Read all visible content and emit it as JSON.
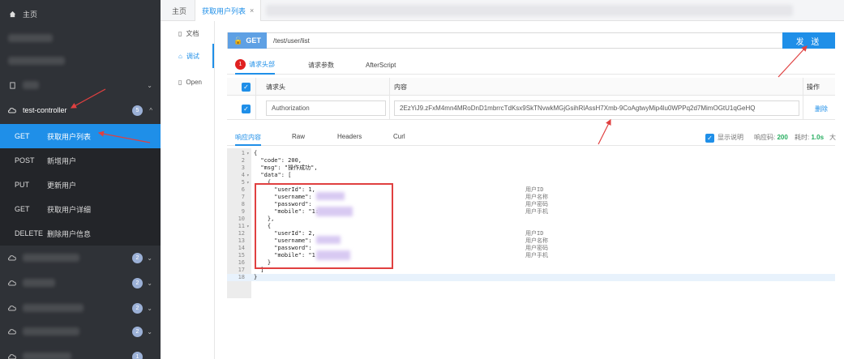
{
  "sidebar": {
    "home_label": "主页",
    "group_label": "test-controller",
    "group_badge": "5",
    "other_badges": [
      "2",
      "2",
      "2",
      "2",
      "1"
    ],
    "endpoints": [
      {
        "method": "GET",
        "name": "获取用户列表"
      },
      {
        "method": "POST",
        "name": "新增用户"
      },
      {
        "method": "PUT",
        "name": "更新用户"
      },
      {
        "method": "GET",
        "name": "获取用户详细"
      },
      {
        "method": "DELETE",
        "name": "删除用户信息"
      }
    ]
  },
  "tabs": {
    "home": "主页",
    "current": "获取用户列表",
    "close_icon": "×"
  },
  "subnav": {
    "doc": "文档",
    "debug": "调试",
    "open": "Open"
  },
  "request": {
    "method": "GET",
    "url": "/test/user/list",
    "send_label": "发 送",
    "tabs": {
      "step": "1",
      "headers": "请求头部",
      "params": "请求参数",
      "after_script": "AfterScript"
    }
  },
  "header_table": {
    "col_name": "请求头",
    "col_value": "内容",
    "col_action": "操作",
    "row": {
      "name": "Authorization",
      "value": "2EzYiJ9.zFxM4mn4MRoDnD1mbrrcTdKsx9SkTNvwkMGjGsihRlAssH7Xmb-9CoAgtwyMip4lu0WPPq2d7MimOGtU1qGeHQ",
      "action": "删除"
    }
  },
  "response": {
    "tabs": {
      "content": "响应内容",
      "raw": "Raw",
      "headers": "Headers",
      "curl": "Curl"
    },
    "show_desc": "显示说明",
    "status_label": "响应码:",
    "status_value": "200",
    "time_label": "耗时:",
    "time_value": "1.0s",
    "size_label": "大"
  },
  "code_lines": [
    {
      "n": "1",
      "fold": "▾",
      "code": "{",
      "cmt": ""
    },
    {
      "n": "2",
      "fold": "",
      "code": "  \"code\": 200,",
      "cmt": ""
    },
    {
      "n": "3",
      "fold": "",
      "code": "  \"msg\": \"操作成功\",",
      "cmt": ""
    },
    {
      "n": "4",
      "fold": "▾",
      "code": "  \"data\": [",
      "cmt": ""
    },
    {
      "n": "5",
      "fold": "▾",
      "code": "    {",
      "cmt": ""
    },
    {
      "n": "6",
      "fold": "",
      "code": "      \"userId\": 1,",
      "cmt": "用户ID"
    },
    {
      "n": "7",
      "fold": "",
      "code": "      \"username\":",
      "cmt": "用户名称"
    },
    {
      "n": "8",
      "fold": "",
      "code": "      \"password\":",
      "cmt": "用户密码"
    },
    {
      "n": "9",
      "fold": "",
      "code": "      \"mobile\": \"1:",
      "cmt": "用户手机"
    },
    {
      "n": "10",
      "fold": "",
      "code": "    },",
      "cmt": ""
    },
    {
      "n": "11",
      "fold": "▾",
      "code": "    {",
      "cmt": ""
    },
    {
      "n": "12",
      "fold": "",
      "code": "      \"userId\": 2,",
      "cmt": "用户ID"
    },
    {
      "n": "13",
      "fold": "",
      "code": "      \"username\":",
      "cmt": "用户名称"
    },
    {
      "n": "14",
      "fold": "",
      "code": "      \"password\":",
      "cmt": "用户密码"
    },
    {
      "n": "15",
      "fold": "",
      "code": "      \"mobile\": \"1",
      "cmt": "用户手机"
    },
    {
      "n": "16",
      "fold": "",
      "code": "    }",
      "cmt": ""
    },
    {
      "n": "17",
      "fold": "",
      "code": "  ]",
      "cmt": ""
    },
    {
      "n": "18",
      "fold": "",
      "code": "}",
      "cmt": ""
    }
  ],
  "colors": {
    "accent": "#1f8fe8",
    "sidebar_bg": "#2f3237",
    "annotation": "#e04040"
  }
}
